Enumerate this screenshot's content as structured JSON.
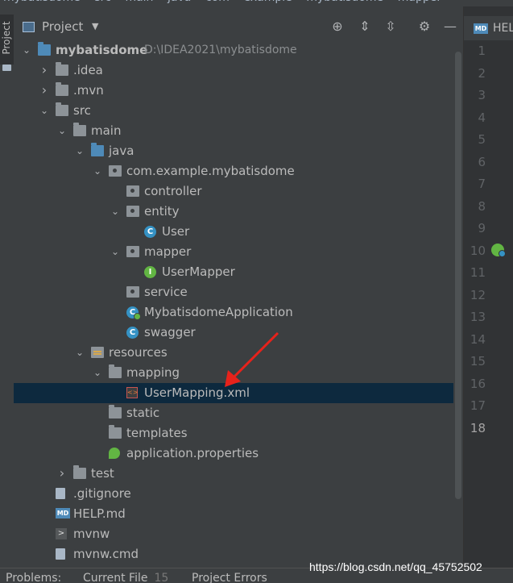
{
  "breadcrumb": [
    "mybatisdome",
    "src",
    "main",
    "java",
    "com",
    "example",
    "mybatisdome",
    "mapper"
  ],
  "left_strip": {
    "label": "Project"
  },
  "panel": {
    "title": "Project",
    "toolbar": {
      "locate": "⊕",
      "expand": "⇕",
      "collapse": "⇳",
      "settings": "⚙",
      "hide": "—"
    }
  },
  "tree": [
    {
      "label": "mybatisdome",
      "path": "D:\\IDEA2021\\mybatisdome",
      "depth": 0,
      "arrow": "expanded",
      "icon": "folder-blue",
      "bold": true
    },
    {
      "label": ".idea",
      "depth": 1,
      "arrow": "collapsed",
      "icon": "folder"
    },
    {
      "label": ".mvn",
      "depth": 1,
      "arrow": "collapsed",
      "icon": "folder"
    },
    {
      "label": "src",
      "depth": 1,
      "arrow": "expanded",
      "icon": "folder"
    },
    {
      "label": "main",
      "depth": 2,
      "arrow": "expanded",
      "icon": "folder"
    },
    {
      "label": "java",
      "depth": 3,
      "arrow": "expanded",
      "icon": "folder-blue"
    },
    {
      "label": "com.example.mybatisdome",
      "depth": 4,
      "arrow": "expanded",
      "icon": "package"
    },
    {
      "label": "controller",
      "depth": 5,
      "arrow": "none",
      "icon": "package"
    },
    {
      "label": "entity",
      "depth": 5,
      "arrow": "expanded",
      "icon": "package"
    },
    {
      "label": "User",
      "depth": 6,
      "arrow": "none",
      "icon": "class"
    },
    {
      "label": "mapper",
      "depth": 5,
      "arrow": "expanded",
      "icon": "package"
    },
    {
      "label": "UserMapper",
      "depth": 6,
      "arrow": "none",
      "icon": "interface"
    },
    {
      "label": "service",
      "depth": 5,
      "arrow": "none",
      "icon": "package"
    },
    {
      "label": "MybatisdomeApplication",
      "depth": 5,
      "arrow": "none",
      "icon": "app-class"
    },
    {
      "label": "swagger",
      "depth": 5,
      "arrow": "none",
      "icon": "class"
    },
    {
      "label": "resources",
      "depth": 3,
      "arrow": "expanded",
      "icon": "resources"
    },
    {
      "label": "mapping",
      "depth": 4,
      "arrow": "expanded",
      "icon": "folder"
    },
    {
      "label": "UserMapping.xml",
      "depth": 5,
      "arrow": "none",
      "icon": "xml",
      "selected": true
    },
    {
      "label": "static",
      "depth": 4,
      "arrow": "none",
      "icon": "folder"
    },
    {
      "label": "templates",
      "depth": 4,
      "arrow": "none",
      "icon": "folder"
    },
    {
      "label": "application.properties",
      "depth": 4,
      "arrow": "none",
      "icon": "properties"
    },
    {
      "label": "test",
      "depth": 2,
      "arrow": "collapsed",
      "icon": "folder"
    },
    {
      "label": ".gitignore",
      "depth": 1,
      "arrow": "none",
      "icon": "file"
    },
    {
      "label": "HELP.md",
      "depth": 1,
      "arrow": "none",
      "icon": "markdown"
    },
    {
      "label": "mvnw",
      "depth": 1,
      "arrow": "none",
      "icon": "terminal"
    },
    {
      "label": "mvnw.cmd",
      "depth": 1,
      "arrow": "none",
      "icon": "file"
    }
  ],
  "bottom_tabs": [
    {
      "label": "Problems:",
      "count": ""
    },
    {
      "label": "Current File",
      "count": "15"
    },
    {
      "label": "Project Errors",
      "count": ""
    }
  ],
  "editor": {
    "tab_badge": "MD",
    "tab_label": "HELP",
    "line_numbers": [
      "1",
      "2",
      "3",
      "4",
      "5",
      "6",
      "7",
      "8",
      "9",
      "10",
      "11",
      "12",
      "13",
      "14",
      "15",
      "16",
      "17",
      "18"
    ],
    "active_line": "18"
  },
  "watermark": "https://blog.csdn.net/qq_45752502",
  "colors": {
    "selection": "#0d293e",
    "arrow": "#e8221b",
    "panel": "#3c3f41",
    "editor_gutter": "#313335"
  }
}
